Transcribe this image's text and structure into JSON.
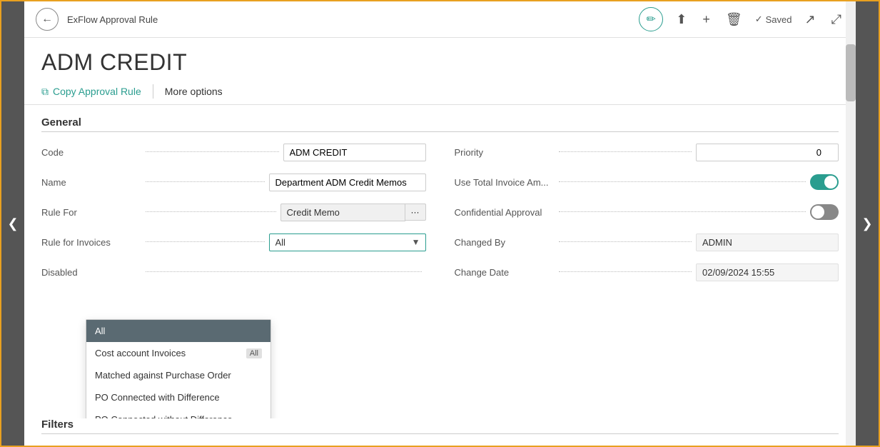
{
  "toolbar": {
    "back_label": "←",
    "title": "ExFlow Approval Rule",
    "edit_icon": "✏",
    "share_icon": "↗",
    "add_icon": "+",
    "delete_icon": "🗑",
    "saved_label": "Saved",
    "external_icon": "↗",
    "expand_icon": "↗"
  },
  "page": {
    "title": "ADM CREDIT",
    "copy_rule_label": "Copy Approval Rule",
    "more_options_label": "More options"
  },
  "general": {
    "section_title": "General",
    "code_label": "Code",
    "code_value": "ADM CREDIT",
    "name_label": "Name",
    "name_value": "Department ADM Credit Memos",
    "rule_for_label": "Rule For",
    "rule_for_value": "Credit Memo",
    "rule_for_invoices_label": "Rule for Invoices",
    "rule_for_invoices_value": "All",
    "disabled_label": "Disabled",
    "priority_label": "Priority",
    "priority_value": "0",
    "use_total_label": "Use Total Invoice Am...",
    "confidential_label": "Confidential Approval",
    "changed_by_label": "Changed By",
    "changed_by_value": "ADMIN",
    "change_date_label": "Change Date",
    "change_date_value": "02/09/2024 15:55"
  },
  "dropdown": {
    "options": [
      {
        "id": "all",
        "label": "All",
        "selected": true,
        "badge": null
      },
      {
        "id": "cost",
        "label": "Cost account Invoices",
        "selected": false,
        "badge": "All"
      },
      {
        "id": "matched",
        "label": "Matched against Purchase Order",
        "selected": false,
        "badge": null
      },
      {
        "id": "po-diff",
        "label": "PO Connected with Difference",
        "selected": false,
        "badge": null
      },
      {
        "id": "po-nodiff",
        "label": "PO Connected without Difference",
        "selected": false,
        "badge": null
      }
    ]
  },
  "filters": {
    "section_title": "Filters"
  },
  "nav": {
    "left_arrow": "❮",
    "right_arrow": "❯"
  }
}
